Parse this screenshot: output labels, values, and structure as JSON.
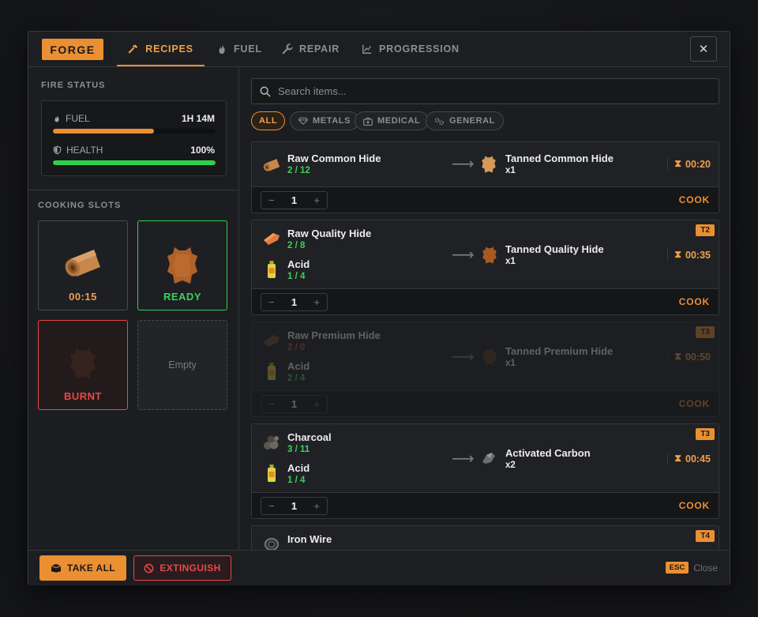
{
  "header": {
    "forge_label": "FORGE",
    "tabs": [
      {
        "label": "RECIPES",
        "icon": "hammer-icon",
        "active": true
      },
      {
        "label": "FUEL",
        "icon": "flame-icon"
      },
      {
        "label": "REPAIR",
        "icon": "wrench-icon"
      },
      {
        "label": "PROGRESSION",
        "icon": "chart-icon"
      }
    ],
    "close": "✕"
  },
  "fire_status": {
    "title": "FIRE STATUS",
    "fuel": {
      "label": "FUEL",
      "value": "1H 14M",
      "level": 0.62,
      "color": "#eb8f33"
    },
    "health": {
      "label": "HEALTH",
      "value": "100%",
      "level": 1.0,
      "color": "#2fd04f"
    }
  },
  "cooking": {
    "title": "COOKING SLOTS",
    "slots": [
      {
        "state": "cooking",
        "label": "00:15",
        "icon": "hide-roll-icon",
        "color": "#f0a04b"
      },
      {
        "state": "ready",
        "label": "READY",
        "icon": "tanned-hide-icon",
        "color": "#3ecf5c"
      },
      {
        "state": "burnt",
        "label": "BURNT",
        "icon": "burnt-hide-icon",
        "color": "#e84848"
      },
      {
        "state": "empty",
        "label": "Empty"
      }
    ]
  },
  "search": {
    "placeholder": "Search items..."
  },
  "filters": [
    {
      "label": "ALL",
      "active": true
    },
    {
      "label": "METALS",
      "icon": "gem-icon"
    },
    {
      "label": "MEDICAL",
      "icon": "medkit-icon"
    },
    {
      "label": "GENERAL",
      "icon": "gears-icon"
    }
  ],
  "recipes": [
    {
      "inputs": [
        {
          "name": "Raw Common Hide",
          "qty": "2 / 12"
        }
      ],
      "output": {
        "name": "Tanned Common Hide",
        "qty": "x1"
      },
      "time": "00:20",
      "amount": "1",
      "cook": "COOK"
    },
    {
      "tier": "T2",
      "inputs": [
        {
          "name": "Raw Quality Hide",
          "qty": "2 / 8"
        },
        {
          "name": "Acid",
          "qty": "1 / 4"
        }
      ],
      "output": {
        "name": "Tanned Quality Hide",
        "qty": "x1"
      },
      "time": "00:35",
      "amount": "1",
      "cook": "COOK"
    },
    {
      "tier": "T3",
      "disabled": true,
      "inputs": [
        {
          "name": "Raw Premium Hide",
          "qty": "2 / 0"
        },
        {
          "name": "Acid",
          "qty": "2 / 4"
        }
      ],
      "output": {
        "name": "Tanned Premium Hide",
        "qty": "x1"
      },
      "time": "00:50",
      "amount": "1",
      "cook": "COOK"
    },
    {
      "tier": "T3",
      "inputs": [
        {
          "name": "Charcoal",
          "qty": "3 / 11"
        },
        {
          "name": "Acid",
          "qty": "1 / 4"
        }
      ],
      "output": {
        "name": "Activated Carbon",
        "qty": "x2"
      },
      "time": "00:45",
      "amount": "1",
      "cook": "COOK"
    },
    {
      "tier": "T4",
      "inputs": [
        {
          "name": "Iron Wire",
          "qty": ""
        }
      ]
    }
  ],
  "footer": {
    "take_all": "TAKE ALL",
    "extinguish": "EXTINGUISH",
    "esc_key": "ESC",
    "close": "Close"
  }
}
